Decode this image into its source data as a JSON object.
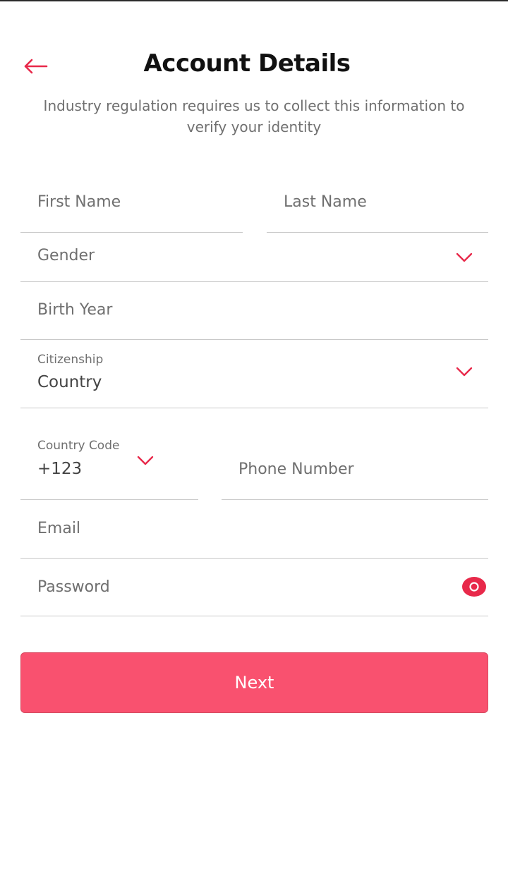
{
  "header": {
    "title": "Account Details",
    "subtitle": "Industry regulation requires us to collect this information to verify your identity",
    "back_icon": "arrow-left-icon"
  },
  "form": {
    "first_name": {
      "placeholder": "First Name"
    },
    "last_name": {
      "placeholder": "Last Name"
    },
    "gender": {
      "placeholder": "Gender",
      "icon": "chevron-down-icon"
    },
    "birth_year": {
      "placeholder": "Birth Year"
    },
    "citizenship": {
      "label": "Citizenship",
      "value": "Country",
      "icon": "chevron-down-icon"
    },
    "country_code": {
      "label": "Country Code",
      "value": "+123",
      "icon": "chevron-down-icon"
    },
    "phone": {
      "placeholder": "Phone Number"
    },
    "email": {
      "placeholder": "Email"
    },
    "password": {
      "placeholder": "Password",
      "icon": "eye-icon"
    }
  },
  "actions": {
    "next_label": "Next"
  },
  "colors": {
    "accent": "#f9516f",
    "accent_icon": "#e8294a",
    "placeholder": "#6f6f6f",
    "divider": "#c8c8c8"
  }
}
